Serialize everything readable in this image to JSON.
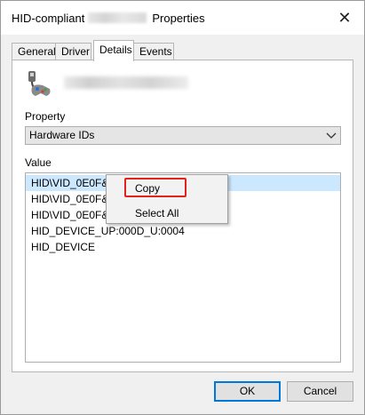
{
  "window": {
    "title_prefix": "HID-compliant",
    "title_suffix": "Properties",
    "close_glyph": "✕"
  },
  "tabs": [
    {
      "label": "General"
    },
    {
      "label": "Driver"
    },
    {
      "label": "Details",
      "active": true
    },
    {
      "label": "Events"
    }
  ],
  "details": {
    "device_icon": "game-controller-icon",
    "property_label": "Property",
    "property_value": "Hardware IDs",
    "value_label": "Value",
    "values": [
      "HID\\VID_0E0F&F",
      "HID\\VID_0E0F&F",
      "HID\\VID_0E0F&U",
      "HID_DEVICE_UP:000D_U:0004",
      "HID_DEVICE"
    ]
  },
  "context_menu": {
    "items": [
      "Copy",
      "Select All"
    ]
  },
  "buttons": {
    "ok": "OK",
    "cancel": "Cancel"
  },
  "colors": {
    "selection": "#cce8ff",
    "annotation_red": "#e2231a",
    "default_button_border": "#0078d7"
  }
}
